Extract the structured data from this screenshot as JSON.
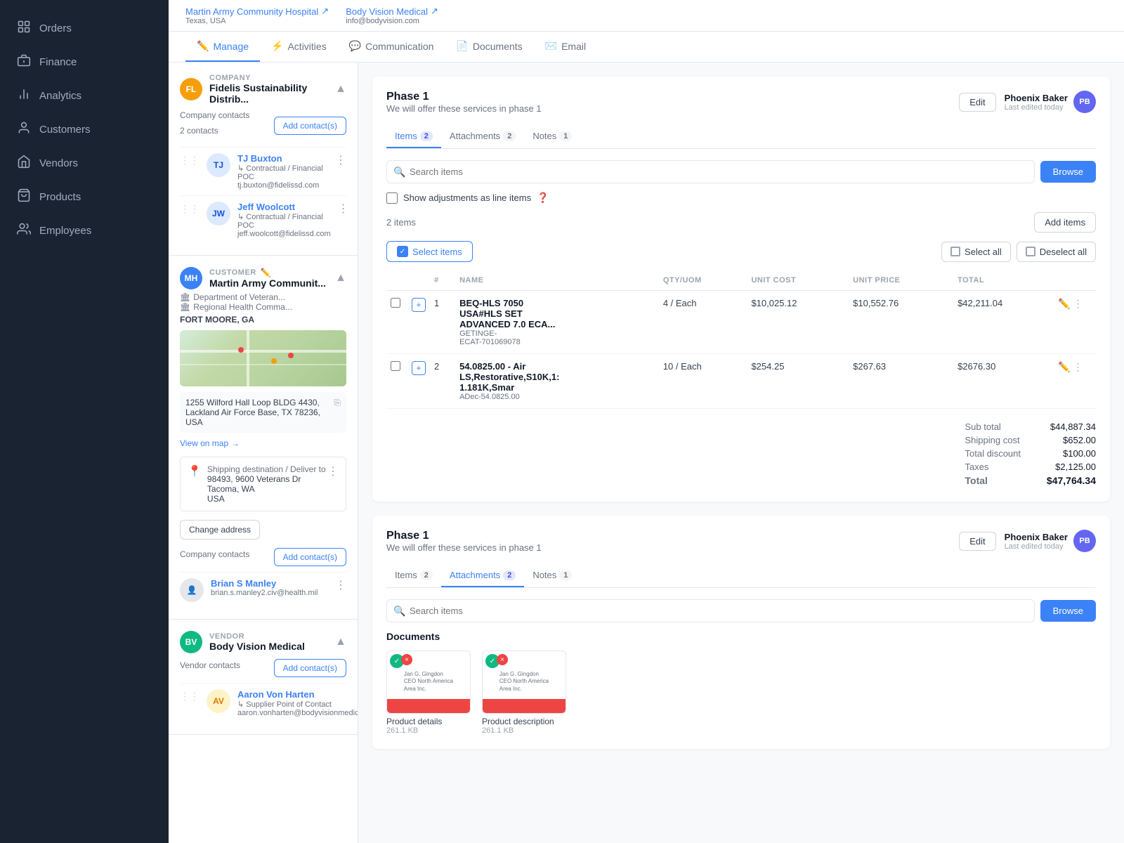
{
  "sidebar": {
    "items": [
      {
        "id": "orders",
        "label": "Orders",
        "icon": "📦"
      },
      {
        "id": "finance",
        "label": "Finance",
        "icon": "💰"
      },
      {
        "id": "analytics",
        "label": "Analytics",
        "icon": "📊"
      },
      {
        "id": "customers",
        "label": "Customers",
        "icon": "👤"
      },
      {
        "id": "vendors",
        "label": "Vendors",
        "icon": "🏢"
      },
      {
        "id": "products",
        "label": "Products",
        "icon": "🛒"
      },
      {
        "id": "employees",
        "label": "Employees",
        "icon": "👥"
      }
    ]
  },
  "topbar": {
    "hospital1": "Martin Army Community Hospital",
    "hospital1_sub": "Texas, USA",
    "hospital2": "Body Vision Medical",
    "hospital2_email": "info@bodyvision.com"
  },
  "tabs": [
    {
      "label": "Manage",
      "active": true
    },
    {
      "label": "Activities"
    },
    {
      "label": "Communication"
    },
    {
      "label": "Documents"
    },
    {
      "label": "Email"
    }
  ],
  "left_panel": {
    "company": {
      "initials": "FL",
      "label": "Company",
      "name": "Fidelis Sustainability Distrib...",
      "contacts_count": "Company contacts",
      "contacts_sub": "2 contacts",
      "add_contacts_label": "Add contact(s)",
      "contacts": [
        {
          "initials": "TJ",
          "name": "TJ Buxton",
          "role": "Contractual / Financial POC",
          "email": "tj.buxton@fidelissd.com"
        },
        {
          "initials": "JW",
          "name": "Jeff Woolcott",
          "role": "Contractual / Financial POC",
          "email": "jeff.woolcott@fidelissd.com"
        }
      ]
    },
    "customer": {
      "label": "CUSTOMER",
      "initials": "MH",
      "name": "Martin Army Communit...",
      "dept1": "Department of Veteran...",
      "dept2": "Regional Health Comma...",
      "location": "FORT MOORE, GA",
      "address": "1255 Wilford Hall Loop BLDG 4430,\nLackland Air Force Base, TX 78236,\nUSA",
      "view_on_map": "View on map",
      "shipping_title": "Shipping destination / Deliver to",
      "shipping_address": "98493, 9600 Veterans Dr\nTacoma, WA\nUSA",
      "change_address": "Change address",
      "contacts_label": "Company contacts",
      "add_contacts_label": "Add contact(s)",
      "contact_name": "Brian S Manley",
      "contact_email": "brian.s.manley2.civ@health.mil"
    },
    "vendor": {
      "label": "Vendor",
      "initials": "BV",
      "name": "Body Vision Medical",
      "contacts_label": "Vendor contacts",
      "add_contacts_label": "Add contact(s)",
      "contact_name": "Aaron Von Harten",
      "contact_role": "Supplier Point of Contact",
      "contact_email": "aaron.vonharten@bodyvisionmedical..."
    }
  },
  "phase1_items": {
    "title": "Phase 1",
    "subtitle": "We will offer these services in phase 1",
    "edit_label": "Edit",
    "user_name": "Phoenix Baker",
    "user_edited": "Last edited today",
    "tabs": [
      {
        "label": "Items",
        "badge": "2",
        "active": true
      },
      {
        "label": "Attachments",
        "badge": "2"
      },
      {
        "label": "Notes",
        "badge": "1"
      }
    ],
    "search_placeholder": "Search items",
    "browse_label": "Browse",
    "show_adjustments": "Show adjustments as line items",
    "items_count": "2 items",
    "add_items_label": "Add items",
    "select_items_label": "Select items",
    "select_all_label": "Select all",
    "deselect_all_label": "Deselect all",
    "table_headers": [
      "#",
      "NAME",
      "QTY/UOM",
      "UNIT COST",
      "UNIT PRICE",
      "TOTAL"
    ],
    "items": [
      {
        "num": "1",
        "name": "BEQ-HLS 7050",
        "name2": "USA#HLS SET",
        "name3": "ADVANCED 7.0 ECA...",
        "code": "GETINGE-",
        "code2": "ECAT-701069078",
        "qty": "4 / Each",
        "unit_cost": "$10,025.12",
        "unit_price": "$10,552.76",
        "total": "$42,211.04"
      },
      {
        "num": "2",
        "name": "54.0825.00 - Air",
        "name2": "LS,Restorative,S10K,1:",
        "name3": "1.181K,Smar",
        "code": "ADec-54.0825.00",
        "qty": "10 / Each",
        "unit_cost": "$254.25",
        "unit_price": "$267.63",
        "total": "$2676.30"
      }
    ],
    "sub_total_label": "Sub total",
    "sub_total_value": "$44,887.34",
    "shipping_cost_label": "Shipping cost",
    "shipping_cost_value": "$652.00",
    "total_discount_label": "Total discount",
    "total_discount_value": "$100.00",
    "taxes_label": "Taxes",
    "taxes_value": "$2,125.00",
    "total_label": "Total",
    "total_value": "$47,764.34"
  },
  "phase1_attachments": {
    "title": "Phase 1",
    "subtitle": "We will offer these services in phase 1",
    "edit_label": "Edit",
    "user_name": "Phoenix Baker",
    "user_edited": "Last edited today",
    "tabs": [
      {
        "label": "Items",
        "badge": "2"
      },
      {
        "label": "Attachments",
        "badge": "2",
        "active": true
      },
      {
        "label": "Notes",
        "badge": "1"
      }
    ],
    "search_placeholder": "Search items",
    "browse_label": "Browse",
    "documents_title": "Documents",
    "docs": [
      {
        "label": "Product details",
        "size": "261.1 KB"
      },
      {
        "label": "Product description",
        "size": "261.1 KB"
      }
    ]
  }
}
